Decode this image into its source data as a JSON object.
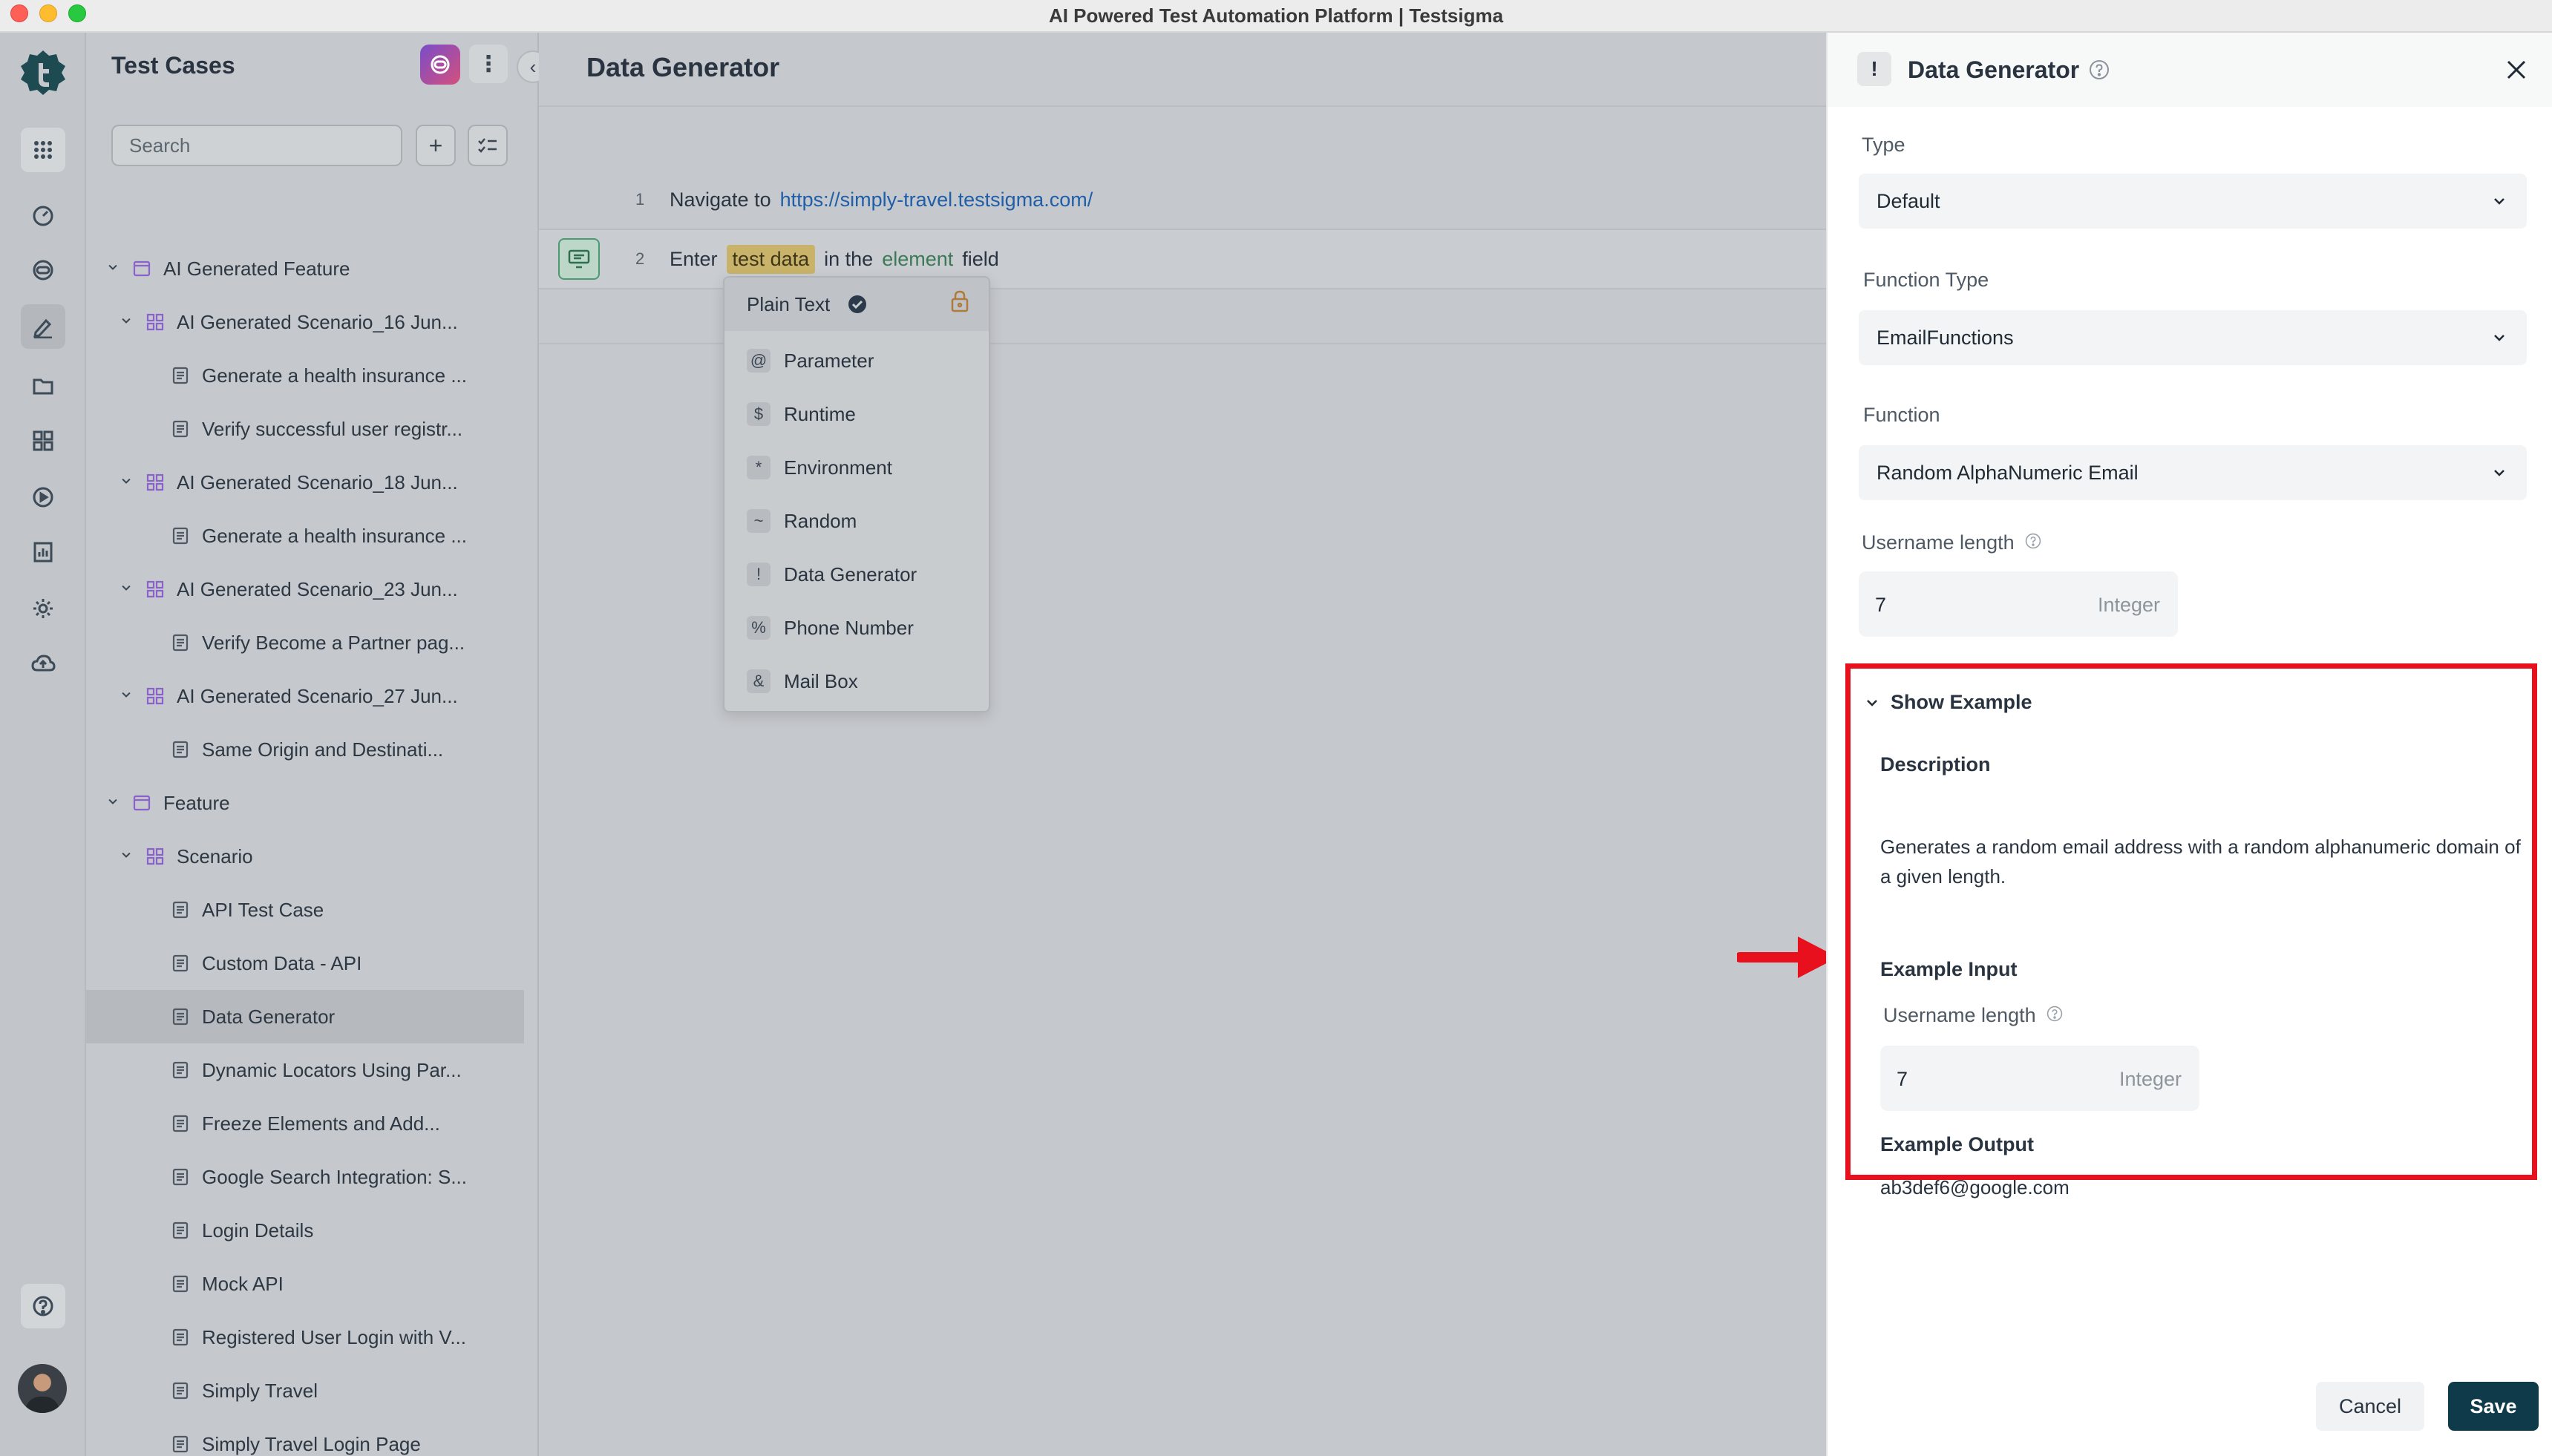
{
  "window": {
    "title": "AI Powered Test Automation Platform | Testsigma"
  },
  "colors": {
    "accent_red": "#e8101c",
    "save_bg": "#0f3a4a",
    "link": "#1f5ea8",
    "element_green": "#3c7a57"
  },
  "left_panel": {
    "title": "Test Cases",
    "search": {
      "placeholder": "Search",
      "value": ""
    },
    "items": [
      {
        "label": "AI Generated Feature",
        "type": "feature",
        "level": 0,
        "expanded": true
      },
      {
        "label": "AI Generated Scenario_16 Jun...",
        "type": "scenario",
        "level": 1,
        "expanded": true
      },
      {
        "label": "Generate a health insurance ...",
        "type": "testcase",
        "level": 2
      },
      {
        "label": "Verify successful user registr...",
        "type": "testcase",
        "level": 2
      },
      {
        "label": "AI Generated Scenario_18 Jun...",
        "type": "scenario",
        "level": 1,
        "expanded": true
      },
      {
        "label": "Generate a health insurance ...",
        "type": "testcase",
        "level": 2
      },
      {
        "label": "AI Generated Scenario_23 Jun...",
        "type": "scenario",
        "level": 1,
        "expanded": true
      },
      {
        "label": "Verify Become a Partner pag...",
        "type": "testcase",
        "level": 2
      },
      {
        "label": "AI Generated Scenario_27 Jun...",
        "type": "scenario",
        "level": 1,
        "expanded": true
      },
      {
        "label": "Same Origin and Destinati...",
        "type": "testcase",
        "level": 2
      },
      {
        "label": "Feature",
        "type": "feature",
        "level": 0,
        "expanded": true
      },
      {
        "label": "Scenario",
        "type": "scenario",
        "level": 1,
        "expanded": true
      },
      {
        "label": "API Test Case",
        "type": "testcase",
        "level": 2
      },
      {
        "label": "Custom Data - API",
        "type": "testcase",
        "level": 2
      },
      {
        "label": "Data Generator",
        "type": "testcase",
        "level": 2,
        "selected": true
      },
      {
        "label": "Dynamic Locators Using Par...",
        "type": "testcase",
        "level": 2
      },
      {
        "label": "Freeze Elements and Add...",
        "type": "testcase",
        "level": 2
      },
      {
        "label": "Google Search Integration: S...",
        "type": "testcase",
        "level": 2
      },
      {
        "label": "Login Details",
        "type": "testcase",
        "level": 2
      },
      {
        "label": "Mock API",
        "type": "testcase",
        "level": 2
      },
      {
        "label": "Registered User Login with V...",
        "type": "testcase",
        "level": 2
      },
      {
        "label": "Simply Travel",
        "type": "testcase",
        "level": 2
      },
      {
        "label": "Simply Travel Login Page",
        "type": "testcase",
        "level": 2
      }
    ]
  },
  "editor": {
    "title": "Data Generator",
    "steps": [
      {
        "num": "1",
        "prefix": "Navigate to",
        "url": "https://simply-travel.testsigma.com/"
      },
      {
        "num": "2",
        "w1": "Enter",
        "test_data": "test data",
        "w2": "in the",
        "element": "element",
        "w3": "field"
      }
    ],
    "data_type_menu": {
      "header": "Plain Text",
      "options": [
        {
          "symbol": "@",
          "label": "Parameter"
        },
        {
          "symbol": "$",
          "label": "Runtime"
        },
        {
          "symbol": "*",
          "label": "Environment"
        },
        {
          "symbol": "~",
          "label": "Random"
        },
        {
          "symbol": "!",
          "label": "Data Generator"
        },
        {
          "symbol": "%",
          "label": "Phone Number"
        },
        {
          "symbol": "&",
          "label": "Mail Box"
        }
      ]
    }
  },
  "drawer": {
    "icon_symbol": "!",
    "title": "Data Generator",
    "type_label": "Type",
    "type_value": "Default",
    "function_type_label": "Function Type",
    "function_type_value": "EmailFunctions",
    "function_label": "Function",
    "function_value": "Random AlphaNumeric Email",
    "username_length_label": "Username length",
    "username_length_value": "7",
    "username_length_type": "Integer",
    "example": {
      "toggle_label": "Show Example",
      "description_heading": "Description",
      "description_text": "Generates a random email address with a random alphanumeric domain of a given length.",
      "input_heading": "Example Input",
      "input_label": "Username length",
      "input_value": "7",
      "input_type": "Integer",
      "output_heading": "Example Output",
      "output_value": "ab3def6@google.com"
    },
    "cancel_label": "Cancel",
    "save_label": "Save"
  }
}
